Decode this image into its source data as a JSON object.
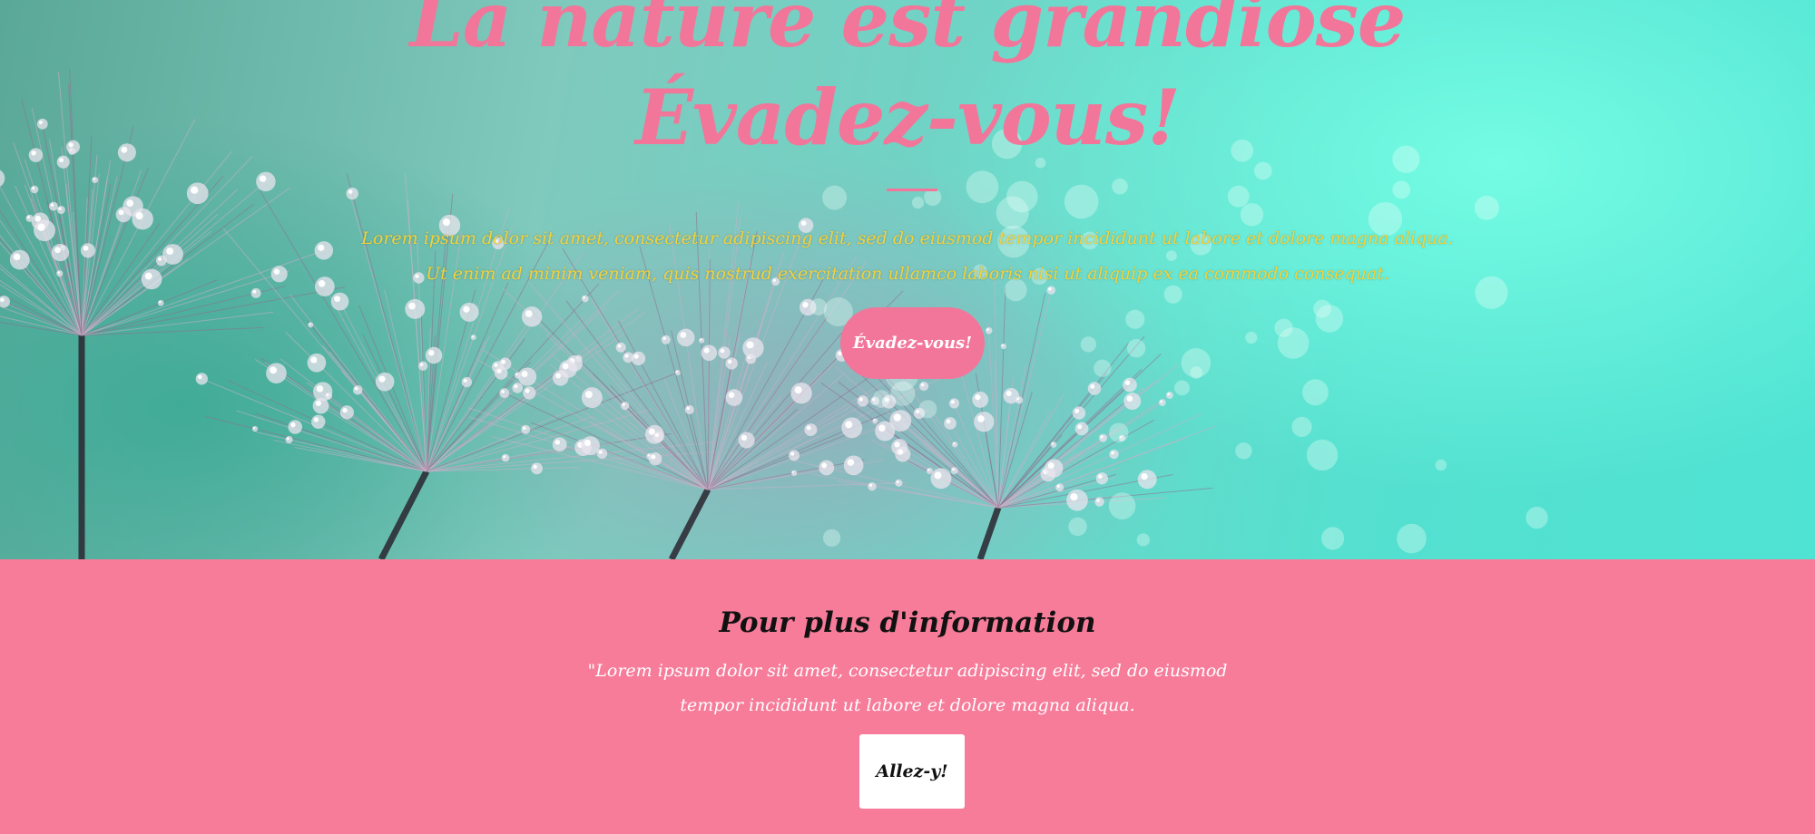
{
  "hero": {
    "title_line1": "La nature est grandiose",
    "title_line2": "Évadez-vous!",
    "text_line1": "Lorem ipsum dolor sit amet, consectetur adipiscing elit, sed do eiusmod tempor incididunt ut labore et dolore magna aliqua.",
    "text_line2": "Ut enim ad minim veniam, quis nostrud exercitation ullamco laboris nisi ut aliquip ex ea commodo consequat.",
    "button_label": "Évadez-vous!",
    "background_image": "dandelion-water-drops-photo"
  },
  "info": {
    "title": "Pour plus d'information",
    "text": "\"Lorem ipsum dolor sit amet, consectetur adipiscing elit, sed do eiusmod tempor incididunt ut labore et dolore magna aliqua.",
    "button_label": "Allez-y!"
  },
  "colors": {
    "pink": "#f67c9a",
    "accent_pink": "#f2769a",
    "teal": "#4fe3d3",
    "yellow": "#f2d23c",
    "white": "#ffffff",
    "dark": "#111111"
  }
}
